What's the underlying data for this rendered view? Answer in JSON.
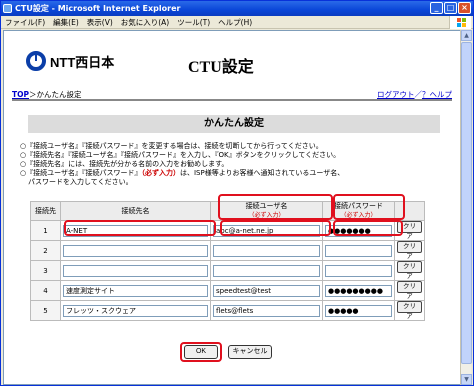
{
  "window": {
    "title": "CTU設定 - Microsoft Internet Explorer"
  },
  "menu": [
    "ファイル(F)",
    "編集(E)",
    "表示(V)",
    "お気に入り(A)",
    "ツール(T)",
    "ヘルプ(H)"
  ],
  "header": {
    "brand": "NTT西日本",
    "title": "CTU設定"
  },
  "nav": {
    "top_link": "TOP",
    "crumb": "＞かんたん設定",
    "logout": "ログアウト",
    "sep": "／",
    "help": "？ヘルプ"
  },
  "section": {
    "title": "かんたん設定"
  },
  "notes": [
    "○『接続ユーザ名』『接続パスワード』を変更する場合は、接続を切断してから行ってください。",
    "○『接続先名』『接続ユーザ名』『接続パスワード』を入力し、『OK』ボタンをクリックしてください。",
    "○『接続先名』には、接続先が分かる名前の入力をお勧めします。",
    "○『接続ユーザ名』『接続パスワード』",
    "（必ず入力）",
    "は、ISP様等よりお客様へ通知されているユーザ名、",
    "パスワードを入力してください。"
  ],
  "table": {
    "headers": {
      "index": "接続先",
      "name": "接続先名",
      "user": "接続ユーザ名",
      "password": "接続パスワード",
      "required": "（必ず入力）"
    },
    "rows": [
      {
        "index": "1",
        "name": "A-NET",
        "user": "abc@a-net.ne.jp",
        "password": "●●●●●●●",
        "clear": "クリア"
      },
      {
        "index": "2",
        "name": "",
        "user": "",
        "password": "",
        "clear": "クリア"
      },
      {
        "index": "3",
        "name": "",
        "user": "",
        "password": "",
        "clear": "クリア"
      },
      {
        "index": "4",
        "name": "速度測定サイト",
        "user": "speedtest@test",
        "password": "●●●●●●●●●",
        "clear": "クリア"
      },
      {
        "index": "5",
        "name": "フレッツ・スクウェア",
        "user": "flets@flets",
        "password": "●●●●●",
        "clear": "クリア"
      }
    ]
  },
  "buttons": {
    "ok": "OK",
    "cancel": "キャンセル"
  },
  "colors": {
    "highlight": "#e0101e",
    "title_blue": "#0a46d8",
    "ntt_blue": "#0b3ea8"
  }
}
